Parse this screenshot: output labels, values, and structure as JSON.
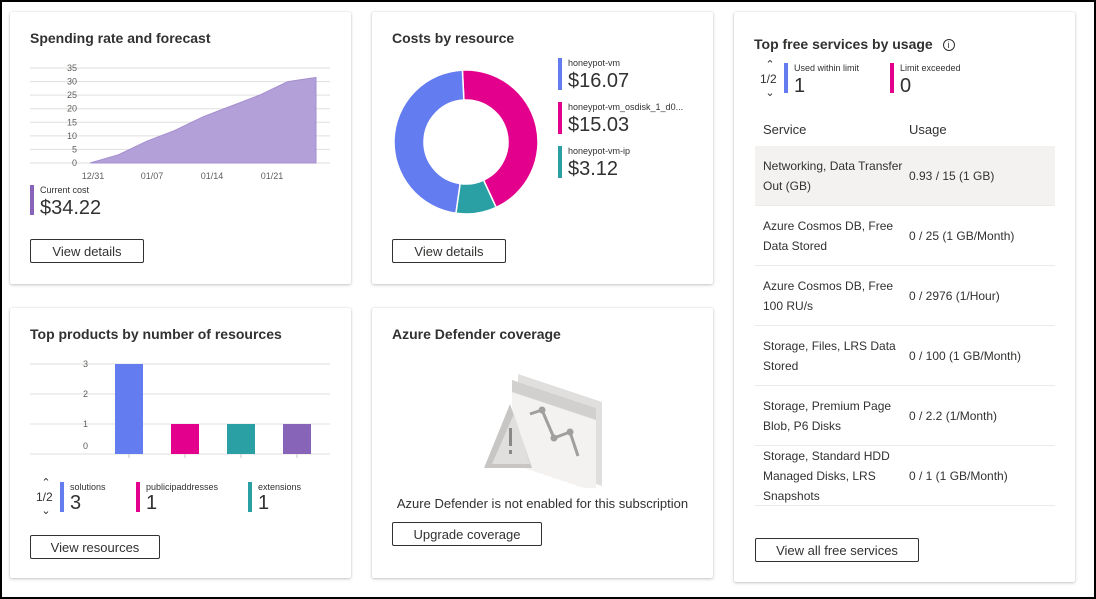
{
  "spending": {
    "title": "Spending rate and forecast",
    "legend_label": "Current cost",
    "legend_value": "$34.22",
    "button": "View details",
    "color": "#8764b8"
  },
  "costs": {
    "title": "Costs by resource",
    "items": [
      {
        "label": "honeypot-vm",
        "value": "$16.07",
        "color": "#637cef"
      },
      {
        "label": "honeypot-vm_osdisk_1_d0...",
        "value": "$15.03",
        "color": "#e3008c"
      },
      {
        "label": "honeypot-vm-ip",
        "value": "$3.12",
        "color": "#2aa0a4"
      }
    ],
    "button": "View details"
  },
  "products": {
    "title": "Top products by number of resources",
    "pager": "1/2",
    "legend": [
      {
        "label": "solutions",
        "value": "3",
        "color": "#637cef"
      },
      {
        "label": "publicipaddresses",
        "value": "1",
        "color": "#e3008c"
      },
      {
        "label": "extensions",
        "value": "1",
        "color": "#2aa0a4"
      }
    ],
    "button": "View resources"
  },
  "defender": {
    "title": "Azure Defender coverage",
    "message": "Azure Defender is not enabled for this subscription",
    "button": "Upgrade coverage"
  },
  "free": {
    "title": "Top free services by usage",
    "pager": "1/2",
    "legend": [
      {
        "label": "Used within limit",
        "value": "1",
        "color": "#637cef"
      },
      {
        "label": "Limit exceeded",
        "value": "0",
        "color": "#e3008c"
      }
    ],
    "headers": {
      "service": "Service",
      "usage": "Usage"
    },
    "rows": [
      {
        "service": "Networking, Data Transfer Out (GB)",
        "usage": "0.93 / 15 (1 GB)"
      },
      {
        "service": "Azure Cosmos DB, Free Data Stored",
        "usage": "0 / 25 (1 GB/Month)"
      },
      {
        "service": "Azure Cosmos DB, Free 100 RU/s",
        "usage": "0 / 2976 (1/Hour)"
      },
      {
        "service": "Storage, Files, LRS Data Stored",
        "usage": "0 / 100 (1 GB/Month)"
      },
      {
        "service": "Storage, Premium Page Blob, P6 Disks",
        "usage": "0 / 2.2 (1/Month)"
      },
      {
        "service": "Storage, Standard HDD Managed Disks, LRS Snapshots",
        "usage": "0 / 1 (1 GB/Month)"
      }
    ],
    "button": "View all free services"
  },
  "chart_data": [
    {
      "type": "area",
      "title": "Spending rate and forecast",
      "x_ticks": [
        "12/31",
        "01/07",
        "01/14",
        "01/21"
      ],
      "y_ticks": [
        0,
        5,
        10,
        15,
        20,
        25,
        30,
        35
      ],
      "ylim": [
        0,
        35
      ],
      "x": [
        "12/31",
        "01/03",
        "01/07",
        "01/10",
        "01/14",
        "01/17",
        "01/21",
        "01/24",
        "01/26"
      ],
      "values": [
        0,
        3,
        8,
        12,
        17,
        21,
        25,
        30,
        31.5
      ],
      "grid": true
    },
    {
      "type": "pie",
      "title": "Costs by resource",
      "categories": [
        "honeypot-vm",
        "honeypot-vm_osdisk_1_d0...",
        "honeypot-vm-ip"
      ],
      "values": [
        16.07,
        15.03,
        3.12
      ],
      "hole": true
    },
    {
      "type": "bar",
      "title": "Top products by number of resources",
      "categories": [
        "solutions",
        "publicipaddresses",
        "extensions",
        ""
      ],
      "values": [
        3,
        1,
        1,
        1
      ],
      "colors": [
        "#637cef",
        "#e3008c",
        "#2aa0a4",
        "#8764b8"
      ],
      "y_ticks": [
        0,
        1,
        2,
        3
      ],
      "ylim": [
        0,
        3
      ]
    }
  ]
}
